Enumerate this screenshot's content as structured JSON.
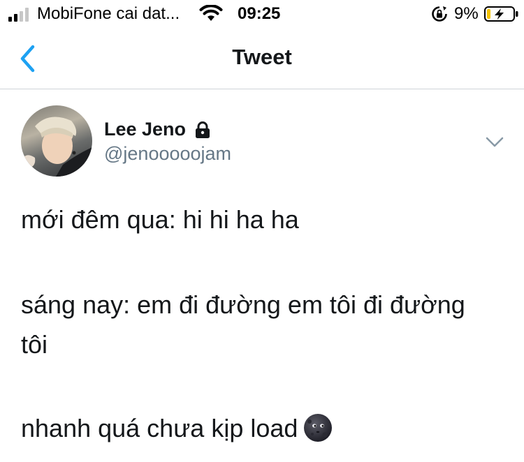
{
  "status_bar": {
    "carrier": "MobiFone cai dat...",
    "time": "09:25",
    "battery_percent": "9%",
    "signal_bars_active": 2,
    "battery_level": 0.09,
    "charging": true,
    "icons": [
      "signal-icon",
      "wifi-icon",
      "rotation-lock-icon",
      "battery-icon"
    ]
  },
  "nav": {
    "title": "Tweet",
    "back_icon": "chevron-left-icon",
    "accent_color": "#1da1f2"
  },
  "tweet": {
    "author": {
      "display_name": "Lee Jeno",
      "handle": "@jenooooojam",
      "protected_icon": "lock-icon"
    },
    "menu_icon": "chevron-down-icon",
    "text_lines": [
      "mới đêm qua: hi hi ha ha",
      "sáng nay: em đi đường em tôi đi đường",
      "tôi",
      "nhanh quá chưa kịp load"
    ],
    "emoji": "new-moon-face-icon"
  },
  "colors": {
    "text_primary": "#14171a",
    "text_secondary": "#657786",
    "divider": "#cfd4d8",
    "battery_low": "#f5c400"
  }
}
